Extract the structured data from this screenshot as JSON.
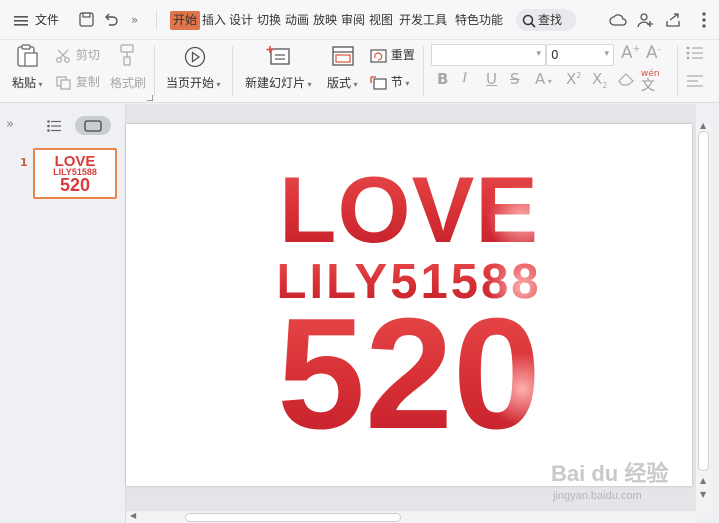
{
  "menubar": {
    "file_label": "文件",
    "tabs": [
      "开始",
      "插入",
      "设计",
      "切换",
      "动画",
      "放映",
      "审阅",
      "视图",
      "开发工具",
      "特色功能"
    ],
    "search_label": "查找"
  },
  "ribbon": {
    "paste": "粘贴",
    "cut": "剪切",
    "copy": "复制",
    "format_painter": "格式刷",
    "start_from_current": "当页开始",
    "new_slide": "新建幻灯片",
    "layout": "版式",
    "reset": "重置",
    "section": "节",
    "font_size_value": "0",
    "phonetic_label": "wén"
  },
  "slide": {
    "line1": "LOVE",
    "line2": "LILY51588",
    "line3": "520"
  },
  "thumbnail": {
    "number": "1",
    "line1": "LOVE",
    "line2": "LILY51588",
    "line3": "520"
  },
  "watermark": {
    "brand": "Bai du 经验",
    "url": "jingyan.baidu.com"
  },
  "colors": {
    "accent": "#e0744a",
    "text_red": "#d62f35"
  }
}
